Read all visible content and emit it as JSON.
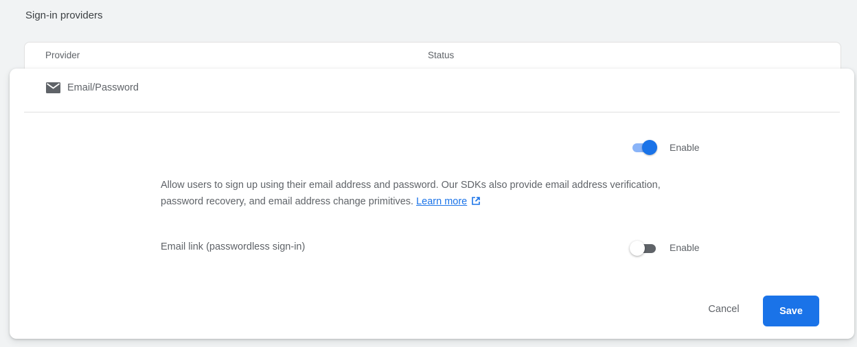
{
  "section": {
    "title": "Sign-in providers"
  },
  "table": {
    "columns": [
      "Provider",
      "Status"
    ]
  },
  "provider": {
    "name": "Email/Password",
    "icon": "mail-icon",
    "enable_toggle": {
      "label": "Enable",
      "checked": true
    },
    "description": "Allow users to sign up using their email address and password. Our SDKs also provide email address verification, password recovery, and email address change primitives.",
    "learn_more": "Learn more",
    "email_link": {
      "label": "Email link (passwordless sign-in)",
      "enable_toggle": {
        "label": "Enable",
        "checked": false
      }
    }
  },
  "actions": {
    "cancel": "Cancel",
    "save": "Save"
  },
  "colors": {
    "accent": "#1a73e8",
    "accent_light": "#8ab4f8",
    "text": "#5f6368"
  }
}
